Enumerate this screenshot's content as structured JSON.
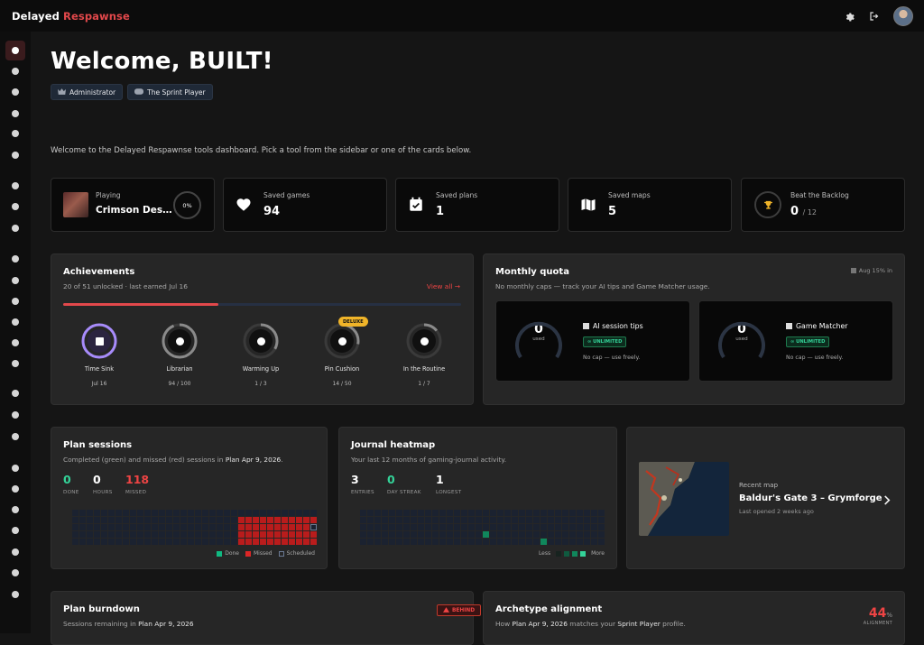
{
  "app": {
    "brand_main": "Delayed",
    "brand_accent": "Respawnse",
    "accent_color": "#e2484b"
  },
  "header": {
    "settings_icon": "gear-icon",
    "logout_icon": "logout-icon",
    "avatar": "user-avatar"
  },
  "sidebar": {
    "items": [
      "dashboard",
      "achievements",
      "journal",
      "notes",
      "history",
      "trophies",
      "favorites",
      "calendar",
      "maps",
      "help",
      "gamepad",
      "schedule",
      "library",
      "magic",
      "quota",
      "bugs",
      "discover",
      "map-pin",
      "stats",
      "trends",
      "saves",
      "controller",
      "stars",
      "network",
      "hierarchy"
    ]
  },
  "welcome": {
    "title": "Welcome, BUILT!",
    "badge_admin": "Administrator",
    "badge_profile": "The Sprint Player"
  },
  "intro": "Welcome to the Delayed Respawnse tools dashboard. Pick a tool from the sidebar or one of the cards below.",
  "stats": {
    "playing_label": "Playing",
    "playing_value": "Crimson Des…",
    "playing_pct": "0%",
    "saved_games_label": "Saved games",
    "saved_games_value": "94",
    "saved_plans_label": "Saved plans",
    "saved_plans_value": "1",
    "saved_maps_label": "Saved maps",
    "saved_maps_value": "5",
    "backlog_label": "Beat the Backlog",
    "backlog_value": "0",
    "backlog_total": "/ 12"
  },
  "achievements": {
    "title": "Achievements",
    "subtitle": "20 of 51 unlocked · last earned Jul 16",
    "view_all": "View all →",
    "progress": 0.39,
    "items": [
      {
        "name": "Time Sink",
        "progress": "Jul 16",
        "fill": 1.0
      },
      {
        "name": "Librarian",
        "progress": "94 / 100",
        "fill": 0.94
      },
      {
        "name": "Warming Up",
        "progress": "1 / 3",
        "fill": 0.33
      },
      {
        "name": "Pin Cushion",
        "progress": "14 / 50",
        "fill": 0.28,
        "tag": "DELUXE"
      },
      {
        "name": "In the Routine",
        "progress": "1 / 7",
        "fill": 0.14
      }
    ]
  },
  "quota": {
    "title": "Monthly quota",
    "subtitle": "No monthly caps — track your AI tips and Game Matcher usage.",
    "reset": "Aug 15% in",
    "items": [
      {
        "name": "AI session tips",
        "value": "0",
        "unit": "used",
        "tag": "UNLIMITED",
        "note": "No cap — use freely."
      },
      {
        "name": "Game Matcher",
        "value": "0",
        "unit": "used",
        "tag": "UNLIMITED",
        "note": "No cap — use freely."
      }
    ]
  },
  "plan_sessions": {
    "title": "Plan sessions",
    "subtitle_pre": "Completed (green) and missed (red) sessions in",
    "subtitle_plan": "Plan Apr 9, 2026",
    "done": "0",
    "done_label": "DONE",
    "hours": "0",
    "hours_label": "HOURS",
    "missed": "118",
    "missed_label": "MISSED",
    "legend_done": "Done",
    "legend_missed": "Missed",
    "legend_scheduled": "Scheduled"
  },
  "journal": {
    "title": "Journal heatmap",
    "subtitle": "Your last 12 months of gaming-journal activity.",
    "entries": "3",
    "entries_label": "ENTRIES",
    "streak": "0",
    "streak_label": "DAY STREAK",
    "longest": "1",
    "longest_label": "LONGEST",
    "legend_less": "Less",
    "legend_more": "More"
  },
  "recent_map": {
    "label": "Recent map",
    "name": "Baldur's Gate 3 – Grymforge",
    "opened": "Last opened 2 weeks ago"
  },
  "burndown": {
    "title": "Plan burndown",
    "subtitle_pre": "Sessions remaining in",
    "subtitle_plan": "Plan Apr 9, 2026",
    "status": "BEHIND"
  },
  "archetype": {
    "title": "Archetype alignment",
    "subtitle_pre": "How",
    "subtitle_plan": "Plan Apr 9, 2026",
    "subtitle_mid": "matches your",
    "subtitle_profile": "Sprint Player",
    "subtitle_post": "profile.",
    "pct": "44",
    "pct_sign": "%",
    "pct_label": "ALIGNMENT"
  }
}
